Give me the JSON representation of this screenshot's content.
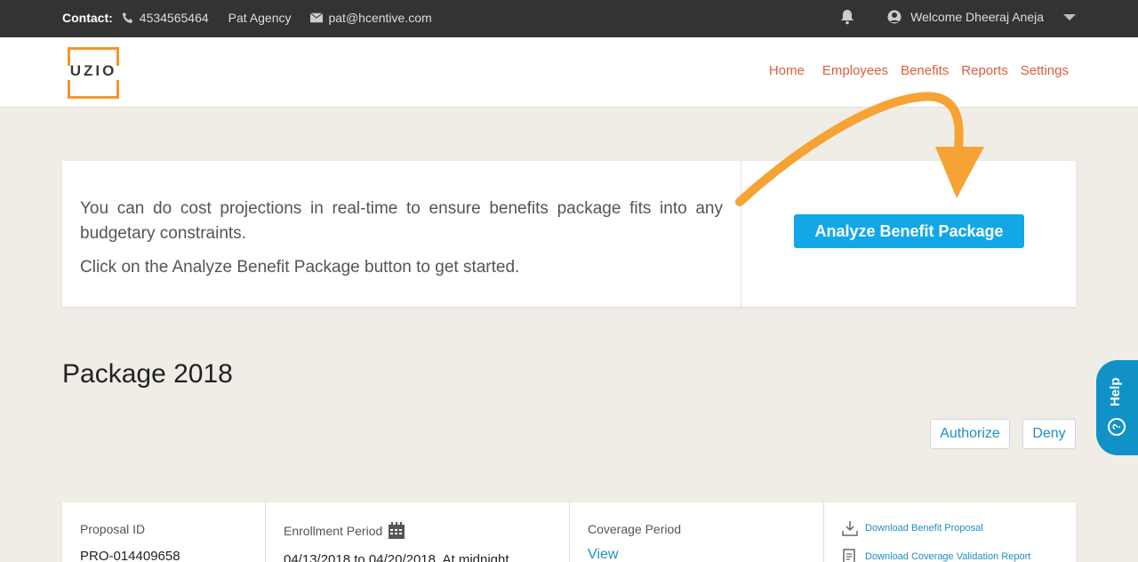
{
  "topbar": {
    "contact_label": "Contact:",
    "phone": "4534565464",
    "agency": "Pat Agency",
    "email": "pat@hcentive.com",
    "welcome": "Welcome Dheeraj Aneja"
  },
  "header": {
    "logo_text": "UZIO",
    "nav": [
      "Home",
      "Employees",
      "Benefits",
      "Reports",
      "Settings"
    ]
  },
  "promo": {
    "line1": "You can do cost projections in real-time to ensure benefits package fits into any budgetary constraints.",
    "line2": "Click on the Analyze Benefit Package button to get started.",
    "button": "Analyze Benefit Package"
  },
  "package": {
    "title": "Package 2018",
    "authorize": "Authorize",
    "deny": "Deny"
  },
  "help": {
    "label": "Help"
  },
  "details": {
    "proposal_id_label": "Proposal ID",
    "proposal_id": "PRO-014409658",
    "enrollment_label": "Enrollment Period",
    "enrollment_value": "04/13/2018 to 04/20/2018, At midnight",
    "coverage_label": "Coverage Period",
    "coverage_link": "View",
    "download_proposal": "Download Benefit Proposal",
    "download_report": "Download Coverage Validation Report"
  },
  "colors": {
    "accent_orange": "#f5962b",
    "nav_red": "#d95f3b",
    "primary_blue": "#12a7e6",
    "link_blue": "#1d8fc3"
  }
}
